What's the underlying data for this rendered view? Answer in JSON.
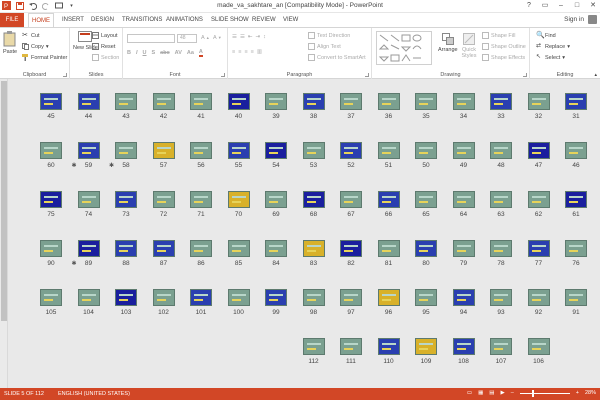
{
  "app": {
    "window_title": "made_va_sakhtare_an [Compatibility Mode] - PowerPoint",
    "sign_in": "Sign in",
    "window_controls": [
      "?",
      "▭",
      "–",
      "□",
      "✕"
    ]
  },
  "tabs": [
    "FILE",
    "HOME",
    "INSERT",
    "DESIGN",
    "TRANSITIONS",
    "ANIMATIONS",
    "SLIDE SHOW",
    "REVIEW",
    "VIEW"
  ],
  "ribbon": {
    "clipboard": {
      "label": "Clipboard",
      "paste": "Paste",
      "cut": "Cut",
      "copy": "Copy",
      "format_painter": "Format Painter"
    },
    "slides": {
      "label": "Slides",
      "new_slide": "New Slide",
      "layout": "Layout",
      "reset": "Reset",
      "section": "Section"
    },
    "font": {
      "label": "Font",
      "size": "48"
    },
    "paragraph": {
      "label": "Paragraph",
      "text_direction": "Text Direction",
      "align_text": "Align Text",
      "convert_smartart": "Convert to SmartArt"
    },
    "drawing": {
      "label": "Drawing",
      "arrange": "Arrange",
      "quick_styles": "Quick Styles",
      "shape_fill": "Shape Fill",
      "shape_outline": "Shape Outline",
      "shape_effects": "Shape Effects"
    },
    "editing": {
      "label": "Editing",
      "find": "Find",
      "replace": "Replace",
      "select": "Select"
    }
  },
  "rows": [
    {
      "numbers": [
        "45",
        "44",
        "43",
        "42",
        "41",
        "40",
        "39",
        "38",
        "37",
        "36",
        "35",
        "34",
        "33",
        "32",
        "31"
      ],
      "stars": []
    },
    {
      "numbers": [
        "60",
        "59",
        "58",
        "57",
        "56",
        "55",
        "54",
        "53",
        "52",
        "51",
        "50",
        "49",
        "48",
        "47",
        "46"
      ],
      "stars": [
        "59",
        "58"
      ]
    },
    {
      "numbers": [
        "75",
        "74",
        "73",
        "72",
        "71",
        "70",
        "69",
        "68",
        "67",
        "66",
        "65",
        "64",
        "63",
        "62",
        "61"
      ],
      "stars": []
    },
    {
      "numbers": [
        "90",
        "89",
        "88",
        "87",
        "86",
        "85",
        "84",
        "83",
        "82",
        "81",
        "80",
        "79",
        "78",
        "77",
        "76"
      ],
      "stars": [
        "89"
      ]
    },
    {
      "numbers": [
        "105",
        "104",
        "103",
        "102",
        "101",
        "100",
        "99",
        "98",
        "97",
        "96",
        "95",
        "94",
        "93",
        "92",
        "91"
      ],
      "stars": []
    },
    {
      "numbers": [
        "",
        "",
        "",
        "",
        "",
        "",
        "",
        "112",
        "111",
        "110",
        "109",
        "108",
        "107",
        "106"
      ],
      "stars": []
    }
  ],
  "status": {
    "slide": "SLIDE 5 OF 112",
    "language": "ENGLISH (UNITED STATES)",
    "zoom": "28%"
  },
  "colors": {
    "accent": "#d24726",
    "slide_bg": "#7ba090"
  }
}
